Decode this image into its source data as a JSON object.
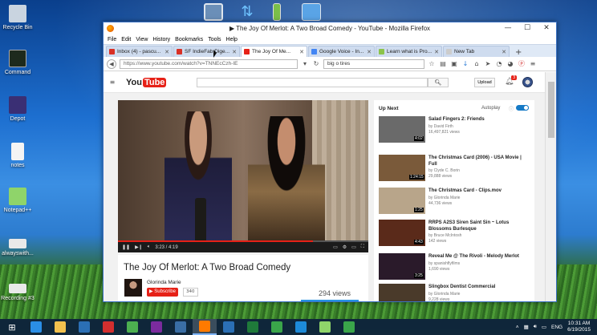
{
  "desktop": {
    "icons": [
      {
        "label": "Recycle Bin",
        "color": "#c9d4e0"
      },
      {
        "label": "Command",
        "color": "#1d2a1d"
      },
      {
        "label": "Depot",
        "color": "#3a2f74"
      },
      {
        "label": "notes",
        "color": "#f4f4f4"
      },
      {
        "label": "Notepad++",
        "color": "#8fd46a"
      },
      {
        "label": "alwayswith...",
        "color": "#e9e9e9"
      },
      {
        "label": "Recording #3",
        "color": "#e9e9e9"
      }
    ]
  },
  "window": {
    "title": "▶ The Joy Of Merlot: A Two Broad Comedy - YouTube - Mozilla Firefox",
    "menu": [
      "File",
      "Edit",
      "View",
      "History",
      "Bookmarks",
      "Tools",
      "Help"
    ],
    "tabs": [
      {
        "label": "Inbox (4) - pascu...",
        "color": "#d93025"
      },
      {
        "label": "SF IndieFab Dige...",
        "color": "#d93025"
      },
      {
        "label": "The Joy Of Me...",
        "color": "#e62117"
      },
      {
        "label": "Google Voice - In...",
        "color": "#4285f4"
      },
      {
        "label": "Learn what is Pro...",
        "color": "#8bc34a"
      },
      {
        "label": "New Tab",
        "color": "#cccccc"
      }
    ],
    "url": "https://www.youtube.com/watch?v=TNNEcCzh-IE",
    "search_value": "big o tires"
  },
  "youtube": {
    "logo_you": "You",
    "logo_tube": "Tube",
    "upload_label": "Upload",
    "notif_count": "3",
    "video": {
      "title": "The Joy Of Merlot: A Two Broad Comedy",
      "channel": "Glorinda Marie",
      "subscribe_label": "Subscribe",
      "sub_count": "340",
      "views": "294 views",
      "time": "3:23 / 4:19",
      "progress_fraction": 0.78
    },
    "up_next_label": "Up Next",
    "autoplay_label": "Autoplay",
    "sidebar": [
      {
        "title": "Salad Fingers 2: Friends",
        "author": "by David Firth",
        "views": "16,497,821 views",
        "duration": "4:02",
        "color": "#6a6a6a"
      },
      {
        "title": "The Christmas Card (2006) - USA Movie | Full",
        "author": "by Clyde C. Borin",
        "views": "29,888 views",
        "duration": "1:24:15",
        "color": "#7a5a3a"
      },
      {
        "title": "The Christmas Card - Clips.mov",
        "author": "by Glorinda Marie",
        "views": "44,736 views",
        "duration": "1:25",
        "color": "#b8a58a"
      },
      {
        "title": "RRPS A2S3 Siren Saint Sin ~ Lotus Blossoms Burlesque",
        "author": "by Bruce McIntosh",
        "views": "142 views",
        "duration": "4:43",
        "color": "#5a2a1a"
      },
      {
        "title": "Reveal Me @ The Rivoli - Melody Merlot",
        "author": "by spanishflyfilms",
        "views": "1,690 views",
        "duration": "3:25",
        "color": "#2a1a2a"
      },
      {
        "title": "Slingbox Dentist Commercial",
        "author": "by Glorinda Marie",
        "views": "9,228 views",
        "duration": "",
        "color": "#4a3a2a"
      }
    ]
  },
  "taskbar": {
    "items": [
      {
        "name": "ie-icon",
        "color": "#2a8ee6"
      },
      {
        "name": "file-explorer-icon",
        "color": "#f2c14e"
      },
      {
        "name": "store-icon",
        "color": "#2b6fb5"
      },
      {
        "name": "power-icon",
        "color": "#d32f2f"
      },
      {
        "name": "chrome-icon",
        "color": "#4caf50"
      },
      {
        "name": "onenote-icon",
        "color": "#7b2b9e"
      },
      {
        "name": "remote-desktop-icon",
        "color": "#3a6ea5"
      },
      {
        "name": "firefox-icon",
        "color": "#ff7a00"
      },
      {
        "name": "store-bag-icon",
        "color": "#2b6fb5"
      },
      {
        "name": "excel-icon",
        "color": "#1f7a3a"
      },
      {
        "name": "media-icon",
        "color": "#3aa54a"
      },
      {
        "name": "skype-icon",
        "color": "#1d8ad8"
      },
      {
        "name": "notepad-plus-icon",
        "color": "#8fd46a"
      },
      {
        "name": "video-app-icon",
        "color": "#3aa54a"
      }
    ],
    "language": "ENG",
    "time": "10:31 AM",
    "date": "6/19/2015"
  }
}
